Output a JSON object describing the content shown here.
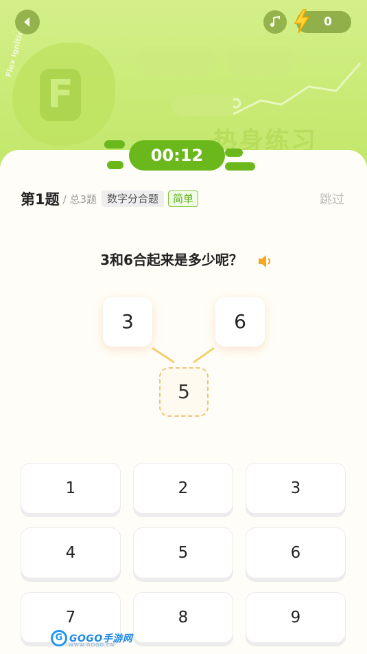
{
  "header": {
    "decor_text": "热身练习",
    "decor_side_text": "Flex Ignition",
    "decor_letter": "F",
    "energy_count": "0"
  },
  "timer": {
    "value": "00:12"
  },
  "question_meta": {
    "number": "第1题",
    "total": "/ 总3题",
    "type_tag": "数字分合题",
    "level_tag": "简单",
    "skip_label": "跳过"
  },
  "question": {
    "text": "3和6合起来是多少呢？"
  },
  "composition": {
    "left": "3",
    "right": "6",
    "answer": "5"
  },
  "keypad": {
    "keys": [
      "1",
      "2",
      "3",
      "4",
      "5",
      "6",
      "7",
      "8",
      "9"
    ]
  },
  "watermark": {
    "circle": "G",
    "text": "GOGO手游网",
    "sub": "WWW.GOGO.CN"
  },
  "colors": {
    "header_bg": "#c8ea74",
    "timer_bg": "#6ab81c",
    "level_tag": "#58b21c",
    "answer_border": "#f0c27a",
    "sound_icon": "#f5a623",
    "energy_icon": "#ffd633"
  }
}
